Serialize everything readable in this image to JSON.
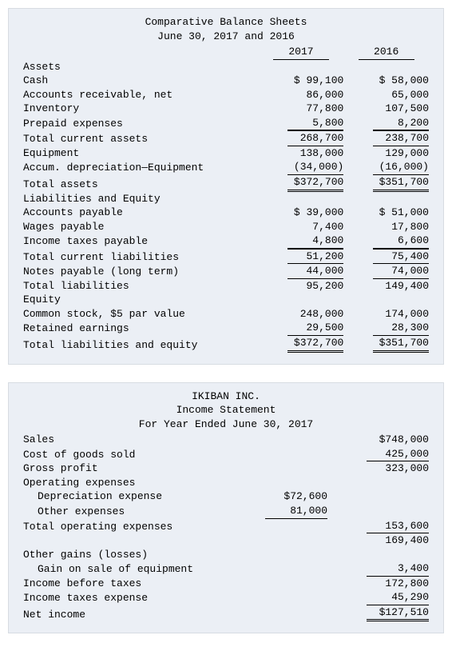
{
  "bs": {
    "title1": "Comparative Balance Sheets",
    "title2": "June 30, 2017 and 2016",
    "col1": "2017",
    "col2": "2016",
    "s_assets": "Assets",
    "rows_assets": [
      {
        "l": "Cash",
        "a": "$ 99,100",
        "b": "$ 58,000"
      },
      {
        "l": "Accounts receivable, net",
        "a": "86,000",
        "b": "65,000"
      },
      {
        "l": "Inventory",
        "a": "77,800",
        "b": "107,500"
      },
      {
        "l": "Prepaid expenses",
        "a": "5,800",
        "b": "8,200",
        "ul": "thin"
      },
      {
        "l": "Total current assets",
        "a": "268,700",
        "b": "238,700",
        "ul": "top"
      },
      {
        "l": "Equipment",
        "a": "138,000",
        "b": "129,000"
      },
      {
        "l": "Accum. depreciation—Equipment",
        "a": "(34,000)",
        "b": "(16,000)",
        "ul": "thin"
      }
    ],
    "total_assets": {
      "l": "Total assets",
      "a": "$372,700",
      "b": "$351,700"
    },
    "s_liab": "Liabilities and Equity",
    "rows_liab": [
      {
        "l": "Accounts payable",
        "a": "$ 39,000",
        "b": "$ 51,000"
      },
      {
        "l": "Wages payable",
        "a": "7,400",
        "b": "17,800"
      },
      {
        "l": "Income taxes payable",
        "a": "4,800",
        "b": "6,600",
        "ul": "thin"
      },
      {
        "l": "Total current liabilities",
        "a": "51,200",
        "b": "75,400",
        "ul": "top"
      },
      {
        "l": "Notes payable (long term)",
        "a": "44,000",
        "b": "74,000",
        "ul": "thin"
      },
      {
        "l": "Total liabilities",
        "a": "95,200",
        "b": "149,400"
      }
    ],
    "s_equity": "Equity",
    "rows_equity": [
      {
        "l": "Common stock, $5 par value",
        "a": "248,000",
        "b": "174,000"
      },
      {
        "l": "Retained earnings",
        "a": "29,500",
        "b": "28,300",
        "ul": "thin"
      }
    ],
    "total_le": {
      "l": "Total liabilities and equity",
      "a": "$372,700",
      "b": "$351,700"
    }
  },
  "is": {
    "title1": "IKIBAN INC.",
    "title2": "Income Statement",
    "title3": "For Year Ended June 30, 2017",
    "rows": [
      {
        "l": "Sales",
        "a": "",
        "b": "$748,000"
      },
      {
        "l": "Cost of goods sold",
        "a": "",
        "b": "425,000",
        "ulb": "thin"
      },
      {
        "l": "Gross profit",
        "a": "",
        "b": "323,000"
      },
      {
        "l": "Operating expenses",
        "a": "",
        "b": ""
      },
      {
        "l": "Depreciation expense",
        "indent": true,
        "a": "$72,600",
        "b": ""
      },
      {
        "l": "Other expenses",
        "indent": true,
        "a": "81,000",
        "b": "",
        "ula": "thin"
      },
      {
        "l": "Total operating expenses",
        "a": "",
        "b": "153,600",
        "ulb": "thin"
      },
      {
        "l": "",
        "a": "",
        "b": "169,400"
      },
      {
        "l": "Other gains (losses)",
        "a": "",
        "b": ""
      },
      {
        "l": "Gain on sale of equipment",
        "indent": true,
        "a": "",
        "b": "3,400",
        "ulb": "thin"
      },
      {
        "l": "Income before taxes",
        "a": "",
        "b": "172,800"
      },
      {
        "l": "Income taxes expense",
        "a": "",
        "b": "45,290",
        "ulb": "thin"
      }
    ],
    "net": {
      "l": "Net income",
      "b": "$127,510"
    }
  }
}
